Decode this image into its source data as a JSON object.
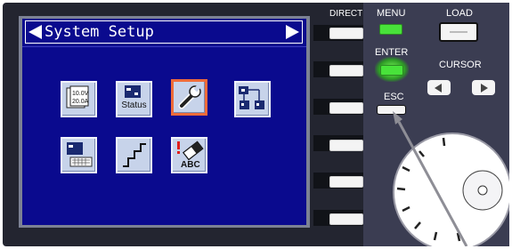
{
  "screen": {
    "title": "System Setup",
    "icons": [
      {
        "name": "range-settings-icon",
        "lines": [
          "10.0V",
          "20.0A"
        ]
      },
      {
        "name": "status-icon",
        "label": "Status"
      },
      {
        "name": "wrench-tool-icon",
        "selected": true
      },
      {
        "name": "network-config-icon"
      },
      {
        "name": "keyboard-input-icon"
      },
      {
        "name": "sequence-steps-icon"
      },
      {
        "name": "abc-eraser-icon",
        "text": "ABC"
      }
    ]
  },
  "panel": {
    "direct_label": "DIRECT",
    "menu_label": "MENU",
    "load_label": "LOAD",
    "enter_label": "ENTER",
    "cursor_label": "CURSOR",
    "esc_label": "ESC",
    "colors": {
      "screen": "#0a0a8e",
      "led_green": "#48e23a",
      "selection": "#ee6b3a",
      "panel": "#232530"
    }
  }
}
